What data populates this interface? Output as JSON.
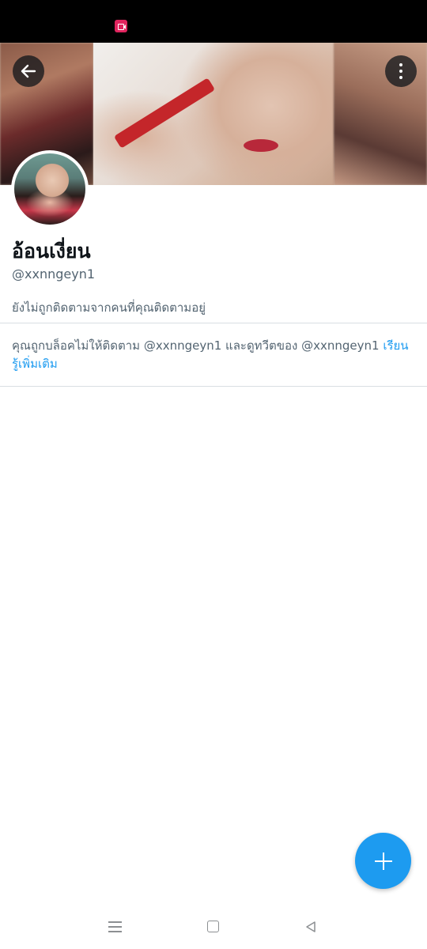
{
  "profile": {
    "display_name": "อ้อนเงี่ยน",
    "handle": "@xxnngeyn1",
    "follow_note": "ยังไม่ถูกติดตามจากคนที่คุณติดตามอยู่"
  },
  "blocked": {
    "message_prefix": "คุณถูกบล็อคไม่ให้ติดตาม @xxnngeyn1 และดูทวีตของ @xxnngeyn1 ",
    "learn_more_link": "เรียนรู้เพิ่มเติม"
  },
  "icons": {
    "status": "screen-record-icon",
    "back": "arrow-left-icon",
    "more": "vertical-dots-icon",
    "compose": "plus-icon",
    "nav": [
      "menu-icon",
      "home-square-icon",
      "back-triangle-icon"
    ]
  },
  "colors": {
    "accent": "#1d9bf0",
    "text_primary": "#0f1419",
    "text_secondary": "#536471",
    "divider": "#d9dee2",
    "status_bar": "#000000"
  }
}
